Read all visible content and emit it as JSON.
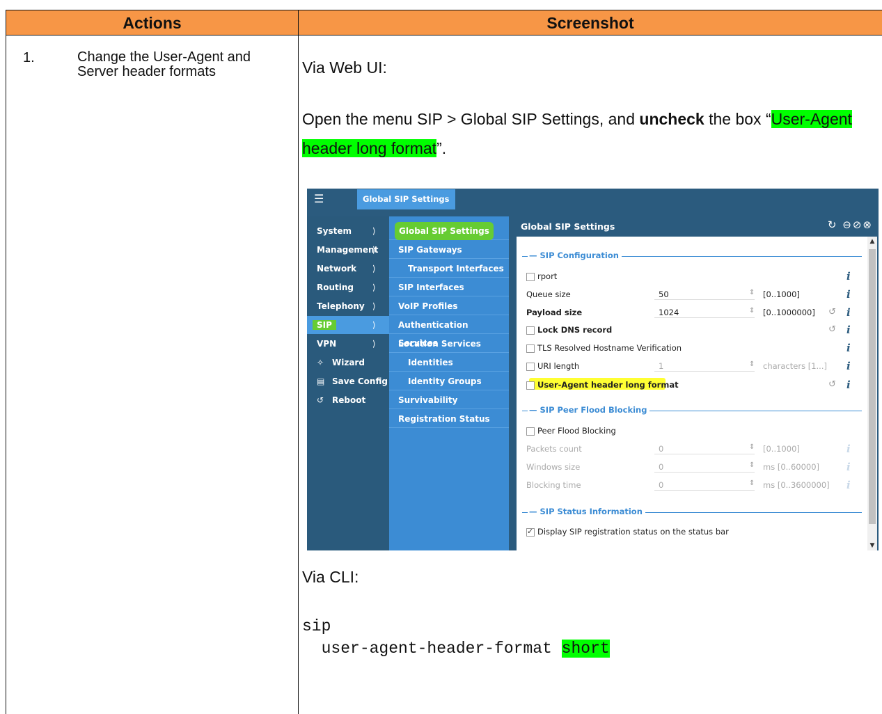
{
  "table": {
    "header_actions": "Actions",
    "header_screenshot": "Screenshot"
  },
  "step": {
    "number": "1.",
    "text": "Change the User-Agent and Server header formats"
  },
  "web": {
    "via_label": "Via Web UI:",
    "instruction_prefix": "Open the menu SIP > Global SIP Settings, and ",
    "instruction_bold": "uncheck",
    "instruction_mid": " the box “",
    "instruction_highlight": "User-Agent header long format",
    "instruction_suffix": "”."
  },
  "cli": {
    "via_label": "Via CLI:",
    "line1": "sip",
    "line2_prefix": "  user-agent-header-format ",
    "line2_highlight": "short"
  },
  "ui": {
    "top_tab": "Global SIP Settings",
    "nav1": [
      {
        "label": "System"
      },
      {
        "label": "Management"
      },
      {
        "label": "Network"
      },
      {
        "label": "Routing"
      },
      {
        "label": "Telephony"
      },
      {
        "label": "SIP"
      },
      {
        "label": "VPN"
      },
      {
        "label": "Wizard"
      },
      {
        "label": "Save Config"
      },
      {
        "label": "Reboot"
      }
    ],
    "nav2": [
      {
        "label": "Global SIP Settings"
      },
      {
        "label": "SIP Gateways"
      },
      {
        "label": "Transport Interfaces"
      },
      {
        "label": "SIP Interfaces"
      },
      {
        "label": "VoIP Profiles"
      },
      {
        "label": "Authentication Services"
      },
      {
        "label": "Location Services"
      },
      {
        "label": "Identities"
      },
      {
        "label": "Identity Groups"
      },
      {
        "label": "Survivability"
      },
      {
        "label": "Registration Status"
      }
    ],
    "panel_title": "Global SIP Settings",
    "sections": {
      "config": "SIP Configuration",
      "flood": "SIP Peer Flood Blocking",
      "status": "SIP Status Information"
    },
    "fields": {
      "rport": "rport",
      "queue_size_label": "Queue size",
      "queue_size_value": "50",
      "queue_size_range": "[0..1000]",
      "payload_size_label": "Payload size",
      "payload_size_value": "1024",
      "payload_size_range": "[0..1000000]",
      "lock_dns": "Lock DNS record",
      "tls_verif": "TLS Resolved Hostname Verification",
      "uri_length_label": "URI length",
      "uri_length_value": "1",
      "uri_length_range": "characters [1...]",
      "ua_long": "User-Agent header long format",
      "peer_flood": "Peer Flood Blocking",
      "packets_label": "Packets count",
      "packets_value": "0",
      "packets_range": "[0..1000]",
      "windows_label": "Windows size",
      "windows_value": "0",
      "windows_range": "ms [0..60000]",
      "blocking_label": "Blocking time",
      "blocking_value": "0",
      "blocking_range": "ms [0..3600000]",
      "display_status": "Display SIP registration status on the status bar"
    }
  }
}
